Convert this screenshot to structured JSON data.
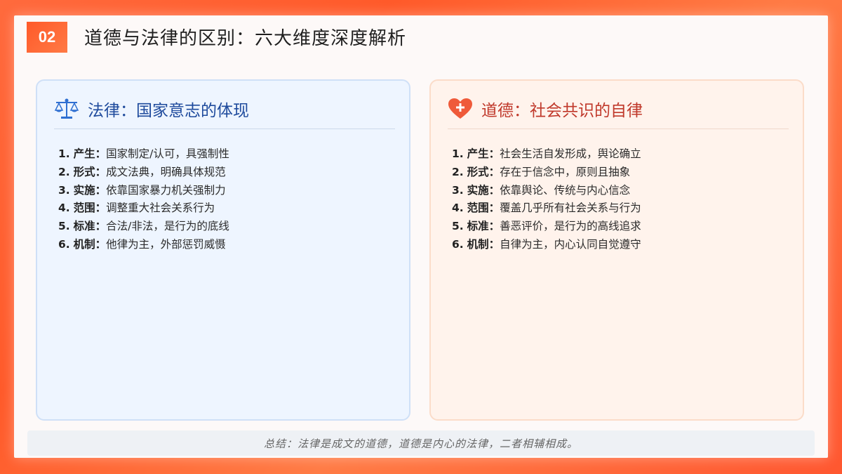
{
  "header": {
    "badge": "02",
    "title": "道德与法律的区别：六大维度深度解析"
  },
  "law": {
    "icon": "scales-icon",
    "title": "法律：国家意志的体现",
    "items": [
      {
        "num": "1.",
        "key": "产生：",
        "text": "国家制定/认可，具强制性"
      },
      {
        "num": "2.",
        "key": "形式：",
        "text": "成文法典，明确具体规范"
      },
      {
        "num": "3.",
        "key": "实施：",
        "text": "依靠国家暴力机关强制力"
      },
      {
        "num": "4.",
        "key": "范围：",
        "text": "调整重大社会关系行为"
      },
      {
        "num": "5.",
        "key": "标准：",
        "text": "合法/非法，是行为的底线"
      },
      {
        "num": "6.",
        "key": "机制：",
        "text": "他律为主，外部惩罚威慑"
      }
    ]
  },
  "moral": {
    "icon": "heart-plus-icon",
    "title": "道德：社会共识的自律",
    "items": [
      {
        "num": "1.",
        "key": "产生：",
        "text": "社会生活自发形成，舆论确立"
      },
      {
        "num": "2.",
        "key": "形式：",
        "text": "存在于信念中，原则且抽象"
      },
      {
        "num": "3.",
        "key": "实施：",
        "text": "依靠舆论、传统与内心信念"
      },
      {
        "num": "4.",
        "key": "范围：",
        "text": "覆盖几乎所有社会关系与行为"
      },
      {
        "num": "5.",
        "key": "标准：",
        "text": "善恶评价，是行为的高线追求"
      },
      {
        "num": "6.",
        "key": "机制：",
        "text": "自律为主，内心认同自觉遵守"
      }
    ]
  },
  "summary": "总结：法律是成文的道德，道德是内心的法律，二者相辅相成。",
  "colors": {
    "accent": "#ff5a2a",
    "law_title": "#1e4a9c",
    "moral_title": "#c0392b"
  }
}
